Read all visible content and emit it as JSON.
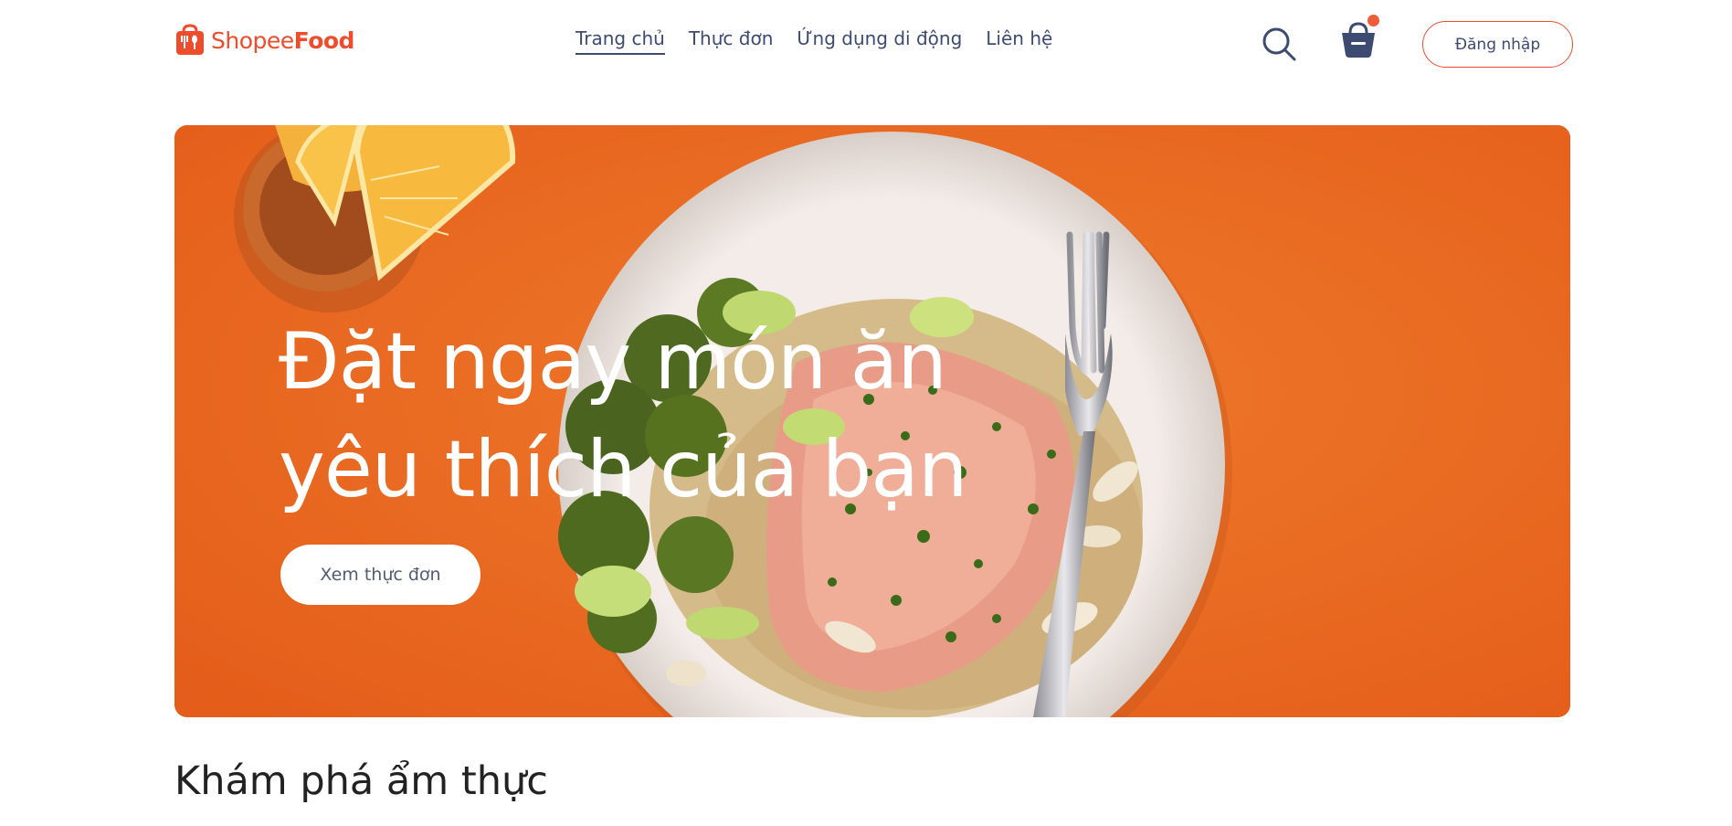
{
  "header": {
    "logo_text_light": "Shopee",
    "logo_text_bold": "Food",
    "nav": [
      {
        "label": "Trang chủ"
      },
      {
        "label": "Thực đơn"
      },
      {
        "label": "Ứng dụng di động"
      },
      {
        "label": "Liên hệ"
      }
    ],
    "login_label": "Đăng nhập"
  },
  "hero": {
    "title_line1": "Đặt ngay món ăn",
    "title_line2": "yêu thích của bạn",
    "cta_label": "Xem thực đơn"
  },
  "section": {
    "title": "Khám phá ẩm thực"
  },
  "colors": {
    "brand": "#ee4d2d",
    "nav_text": "#3d4a72",
    "hero_bg": "#ea6a22"
  },
  "icons": [
    "shopeefood-logo-icon",
    "search-icon",
    "basket-icon",
    "notification-dot"
  ]
}
